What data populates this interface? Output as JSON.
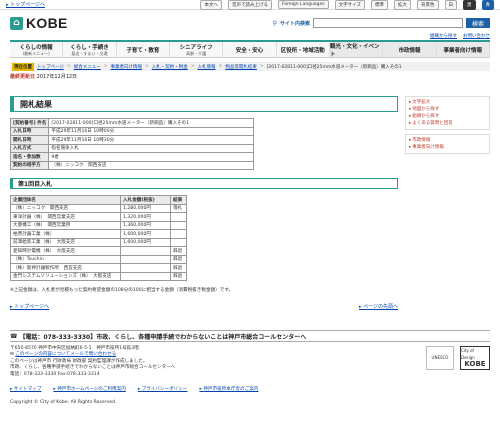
{
  "topbar": {
    "top_link": "トップページへ",
    "items": [
      "本文へ",
      "音声で読み上げる",
      "Foreign Languages",
      "文字サイズ",
      "標準",
      "拡大",
      "背景色",
      "白",
      "黒",
      "青"
    ]
  },
  "header": {
    "logo_text": "KOBE",
    "search_label": "サイト内検索",
    "search_placeholder": "",
    "search_button": "検索",
    "links": [
      "組織から探す",
      "お問い合わせ"
    ]
  },
  "nav": [
    {
      "label": "くらしの情報",
      "sub": "(最新メニュー)"
    },
    {
      "label": "くらし・手続き",
      "sub": "届出・すまい・交通"
    },
    {
      "label": "子育て・教育",
      "sub": ""
    },
    {
      "label": "シニアライフ",
      "sub": "高齢・介護"
    },
    {
      "label": "安全・安心",
      "sub": ""
    },
    {
      "label": "区役所・地域活動",
      "sub": ""
    },
    {
      "label": "観光・文化・イベント",
      "sub": ""
    },
    {
      "label": "市政情報",
      "sub": ""
    },
    {
      "label": "事業者向け情報",
      "sub": ""
    }
  ],
  "breadcrumb": {
    "here": "現在位置",
    "items": [
      "トップページ",
      "総合メニュー",
      "事業者向け情報",
      "入札・契約・税金",
      "入札情報",
      "物品等開札結果",
      "[2017-02811-000]口径25mm水道メーター（新銅品）購入その1"
    ]
  },
  "updated": {
    "label": "最終更新日",
    "value": "2017年12月12日"
  },
  "page_title": "開札結果",
  "info": [
    {
      "label": "[契約番号] 件名",
      "value": "[2017-02811-000]口径25mm水道メーター（新銅品）購入その1"
    },
    {
      "label": "入札日時",
      "value": "平成29年11月16日 10時00分"
    },
    {
      "label": "開札日時",
      "value": "平成29年11月16日 10時30分"
    },
    {
      "label": "入札方式",
      "value": "指名競争入札"
    },
    {
      "label": "指名・参加数",
      "value": "9者"
    },
    {
      "label": "契約の相手方",
      "value": "（株）ニッコク　関西支店"
    }
  ],
  "round_title": "第1回目入札",
  "results": {
    "headers": [
      "企業団体名",
      "入札金額(税抜)",
      "結果"
    ],
    "rows": [
      [
        "（株）ニッコク　関西支店",
        "1,280,000円",
        "落札"
      ],
      [
        "東洋計器（株）　関西営業支店",
        "1,320,000円",
        ""
      ],
      [
        "大豊機工（株）　関西営業所",
        "1,360,000円",
        ""
      ],
      [
        "柏原計器工業（株）",
        "1,600,000円",
        ""
      ],
      [
        "前澤給装工業（株）　大阪支店",
        "1,600,000円",
        ""
      ],
      [
        "愛知時計電機（株）　大阪支店",
        "",
        "辞退"
      ],
      [
        "（株）Tsuchin",
        "",
        "辞退"
      ],
      [
        "（株）阪神計器製作所　西宮支店",
        "",
        "辞退"
      ],
      [
        "金門システムソリューションズ（株）　大阪支店",
        "",
        "辞退"
      ]
    ]
  },
  "note": "※上記金額は、入札者が見積もった契約希望金額の108分の100に相当する金額（消費税抜き税金額）です。",
  "pager": {
    "prev": "トップページへ",
    "next": "ページの先頭へ"
  },
  "sidebar": {
    "group1": [
      "文字拡大",
      "地図から探す",
      "組織から探す",
      "よくある質問と回答"
    ],
    "group2": [
      "市政情報",
      "事業者向け情報"
    ]
  },
  "footer": {
    "contact": "【電話：078-333-3330】市政、くらし、各種申請手続でわからないことは神戸市総合コールセンターへ",
    "address_lines": [
      "〒650-8570 神戸市中央区加納町6-5-1　神戸市役所1号館3階",
      "このページの内容についてメールで問い合わせる",
      "このページは神戸市 行財政局 財政部 契約監理課が作成しました。",
      "市政、くらし、各種申請手続きでわからないことは神戸市総合コールセンターへ",
      "電話：078-333-3330 Fax:078-333-3314"
    ],
    "badge_unesco": "UNESCO",
    "badge_design_top": "City of Design",
    "badge_design_main": "KOBE",
    "links": [
      "サイトマップ",
      "神戸市ホームページのご利用案内",
      "プライバシーポリシー",
      "神戸市役所本庁舎のご案内"
    ],
    "copyright": "Copyright © City of Kobe. All Rights Reserved."
  }
}
